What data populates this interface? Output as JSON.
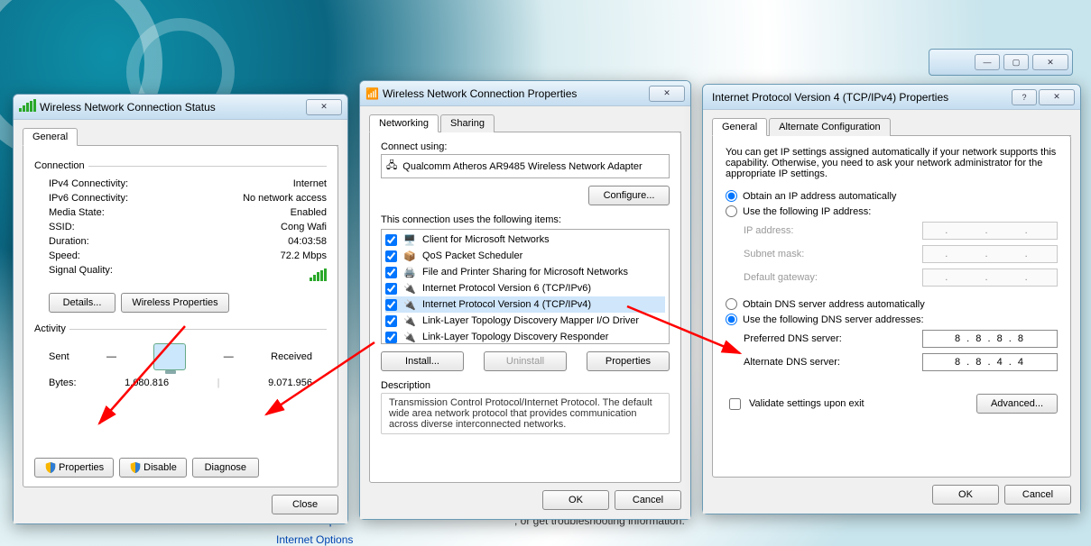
{
  "bg_window": {
    "controls": [
      "min",
      "max",
      "close"
    ]
  },
  "status_dialog": {
    "title": "Wireless Network Connection Status",
    "tab_general": "General",
    "connection_label": "Connection",
    "rows": {
      "ipv4_label": "IPv4 Connectivity:",
      "ipv4_value": "Internet",
      "ipv6_label": "IPv6 Connectivity:",
      "ipv6_value": "No network access",
      "media_label": "Media State:",
      "media_value": "Enabled",
      "ssid_label": "SSID:",
      "ssid_value": "Cong Wafi",
      "duration_label": "Duration:",
      "duration_value": "04:03:58",
      "speed_label": "Speed:",
      "speed_value": "72.2 Mbps",
      "signal_label": "Signal Quality:"
    },
    "btn_details": "Details...",
    "btn_wireless_props": "Wireless Properties",
    "activity_label": "Activity",
    "activity_sent": "Sent",
    "activity_received": "Received",
    "bytes_label": "Bytes:",
    "bytes_sent": "1.080.816",
    "bytes_received": "9.071.956",
    "btn_properties": "Properties",
    "btn_disable": "Disable",
    "btn_diagnose": "Diagnose",
    "btn_close": "Close"
  },
  "conn_props": {
    "title": "Wireless Network Connection Properties",
    "tab_networking": "Networking",
    "tab_sharing": "Sharing",
    "connect_using_label": "Connect using:",
    "adapter": "Qualcomm Atheros AR9485 Wireless Network Adapter",
    "btn_configure": "Configure...",
    "items_label": "This connection uses the following items:",
    "items": [
      {
        "checked": true,
        "icon": "client-icon",
        "label": "Client for Microsoft Networks"
      },
      {
        "checked": true,
        "icon": "qos-icon",
        "label": "QoS Packet Scheduler"
      },
      {
        "checked": true,
        "icon": "fileprint-icon",
        "label": "File and Printer Sharing for Microsoft Networks"
      },
      {
        "checked": true,
        "icon": "protocol-icon",
        "label": "Internet Protocol Version 6 (TCP/IPv6)"
      },
      {
        "checked": true,
        "icon": "protocol-icon",
        "label": "Internet Protocol Version 4 (TCP/IPv4)",
        "selected": true
      },
      {
        "checked": true,
        "icon": "protocol-icon",
        "label": "Link-Layer Topology Discovery Mapper I/O Driver"
      },
      {
        "checked": true,
        "icon": "protocol-icon",
        "label": "Link-Layer Topology Discovery Responder"
      }
    ],
    "btn_install": "Install...",
    "btn_uninstall": "Uninstall",
    "btn_properties": "Properties",
    "desc_label": "Description",
    "desc_text": "Transmission Control Protocol/Internet Protocol. The default wide area network protocol that provides communication across diverse interconnected networks.",
    "btn_ok": "OK",
    "btn_cancel": "Cancel"
  },
  "ipv4_props": {
    "title": "Internet Protocol Version 4 (TCP/IPv4) Properties",
    "tab_general": "General",
    "tab_alt": "Alternate Configuration",
    "intro": "You can get IP settings assigned automatically if your network supports this capability. Otherwise, you need to ask your network administrator for the appropriate IP settings.",
    "radio_ip_auto": "Obtain an IP address automatically",
    "radio_ip_manual": "Use the following IP address:",
    "ip_auto_selected": true,
    "ip_label": "IP address:",
    "subnet_label": "Subnet mask:",
    "gateway_label": "Default gateway:",
    "radio_dns_auto": "Obtain DNS server address automatically",
    "radio_dns_manual": "Use the following DNS server addresses:",
    "dns_manual_selected": true,
    "pref_dns_label": "Preferred DNS server:",
    "pref_dns_value": "8 . 8 . 8 . 8",
    "alt_dns_label": "Alternate DNS server:",
    "alt_dns_value": "8 . 8 . 4 . 4",
    "validate_label": "Validate settings upon exit",
    "validate_checked": false,
    "btn_advanced": "Advanced...",
    "btn_ok": "OK",
    "btn_cancel": "Cancel"
  },
  "sidebar": {
    "homegroup": "HomeGroup",
    "internet_options": "Internet Options",
    "troubleshoot_tail": ", or get troubleshooting information."
  },
  "annotations": {
    "arrow_color": "#ff0000"
  }
}
